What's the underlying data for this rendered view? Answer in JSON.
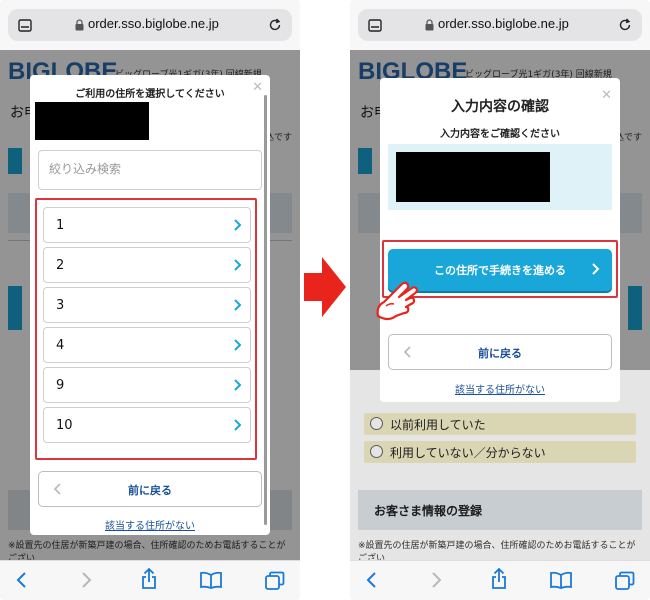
{
  "browser": {
    "url": "order.sso.biglobe.ne.jp"
  },
  "page": {
    "logo": "BIGLOBE",
    "logo_subtitle": "ビッグローブ光1ギガ(3年) 回線新規",
    "heading_fragment": "お申",
    "right_fragment": "込です",
    "radio_options": [
      "以前利用していた",
      "利用していない／分からない"
    ],
    "section_title": "お客さま情報の登録",
    "note": "※設置先の住居が新築戸建の場合、住所確認のためお電話することがござい"
  },
  "modal_left": {
    "title": "ご利用の住所を選択してください",
    "search_placeholder": "絞り込み検索",
    "addresses": [
      "1",
      "2",
      "3",
      "4",
      "9",
      "10"
    ],
    "back_label": "前に戻る",
    "no_match_link": "該当する住所がない"
  },
  "modal_right": {
    "title": "入力内容の確認",
    "subtitle": "入力内容をご確認ください",
    "proceed_label": "この住所で手続きを進める",
    "back_label": "前に戻る",
    "no_match_link": "該当する住所がない"
  },
  "colors": {
    "accent": "#19a6d8",
    "highlight": "#d9363e",
    "link": "#1a4f99",
    "arrow": "#e8241c"
  }
}
